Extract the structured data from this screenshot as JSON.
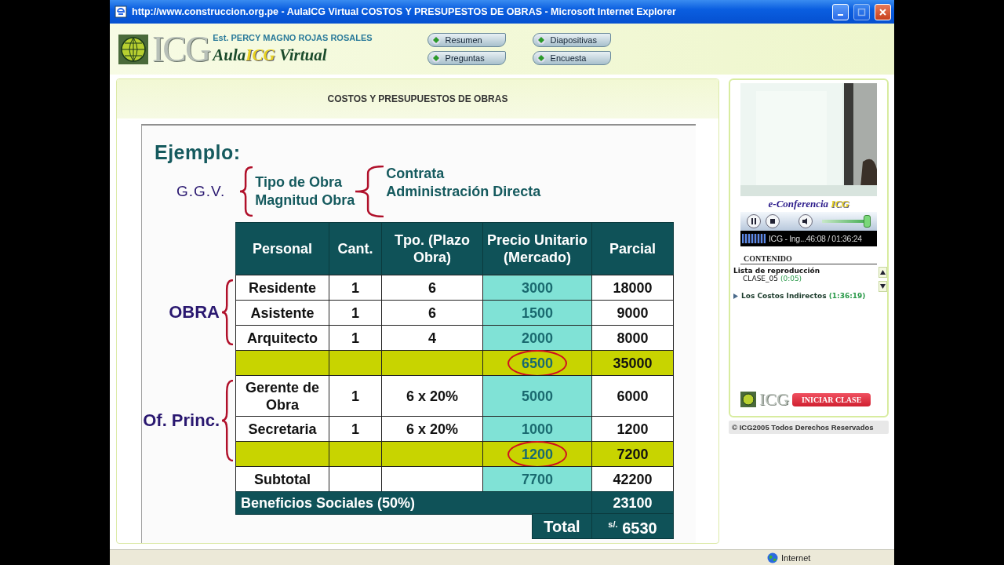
{
  "window": {
    "title": "http://www.construccion.org.pe - AulaICG Virtual COSTOS Y PRESUPESTOS DE OBRAS - Microsoft Internet Explorer",
    "controls": [
      {
        "kind": "minimize",
        "disabled": false
      },
      {
        "kind": "maximize",
        "disabled": true
      },
      {
        "kind": "close",
        "disabled": false
      }
    ]
  },
  "header": {
    "logo_text": "ICG",
    "student": "Est. PERCY MAGNO ROJAS ROSALES",
    "brand": {
      "prefix": "Aula",
      "highlight": "ICG",
      "suffix": " Virtual"
    },
    "nav": [
      {
        "label": "Resumen"
      },
      {
        "label": "Diapositivas"
      },
      {
        "label": "Preguntas"
      },
      {
        "label": "Encuesta"
      }
    ]
  },
  "main": {
    "title": "COSTOS Y PRESUPUESTOS DE OBRAS",
    "slide": {
      "heading": "Ejemplo:",
      "ggv": "G.G.V.",
      "types": [
        "Tipo de Obra",
        "Magnitud Obra"
      ],
      "modes": [
        "Contrata",
        "Administración Directa"
      ],
      "table": {
        "columns": [
          "Personal",
          "Cant.",
          "Tpo. (Plazo Obra)",
          "Precio Unitario (Mercado)",
          "Parcial"
        ],
        "sections": [
          {
            "label": "OBRA",
            "rows": [
              {
                "cells": [
                  "Residente",
                  "1",
                  "6",
                  "3000",
                  "18000"
                ],
                "tall": false
              },
              {
                "cells": [
                  "Asistente",
                  "1",
                  "6",
                  "1500",
                  "9000"
                ],
                "tall": false
              },
              {
                "cells": [
                  "Arquitecto",
                  "1",
                  "4",
                  "2000",
                  "8000"
                ],
                "tall": false
              }
            ],
            "sum": {
              "unit": "6500",
              "parcial": "35000",
              "circled": true
            }
          },
          {
            "label": "Of. Princ.",
            "rows": [
              {
                "cells": [
                  "Gerente de Obra",
                  "1",
                  "6 x 20%",
                  "5000",
                  "6000"
                ],
                "tall": true
              },
              {
                "cells": [
                  "Secretaria",
                  "1",
                  "6 x 20%",
                  "1000",
                  "1200"
                ],
                "tall": false
              }
            ],
            "sum": {
              "unit": "1200",
              "parcial": "7200",
              "circled": true
            }
          }
        ],
        "subtotal": {
          "label": "Subtotal",
          "unit": "7700",
          "parcial": "42200"
        },
        "benefits": {
          "label": "Beneficios Sociales (50%)",
          "value": "23100"
        },
        "total": {
          "label": "Total",
          "value": "$^{s/.}$ 6530"
        }
      }
    }
  },
  "player": {
    "brand": {
      "prefix": "e-Conferencia ",
      "highlight": "ICG"
    },
    "volume": {
      "level": 1.0
    },
    "status": "ICG - Ing...46:08 / 01:36:24",
    "contents_title": "CONTENIDO",
    "playlist_title": "Lista de reproducción",
    "current": {
      "name": "CLASE_05",
      "time": "(0:05)"
    },
    "items": [
      {
        "title": "Los Costos Indirectos",
        "time": "(1:36:19)",
        "expanded": false
      }
    ],
    "logo_text": "ICG",
    "start_button": "INICIAR CLASE",
    "copyright": "© ICG2005 Todos Derechos Reservados"
  },
  "status_bar": {
    "zone": "Internet"
  }
}
